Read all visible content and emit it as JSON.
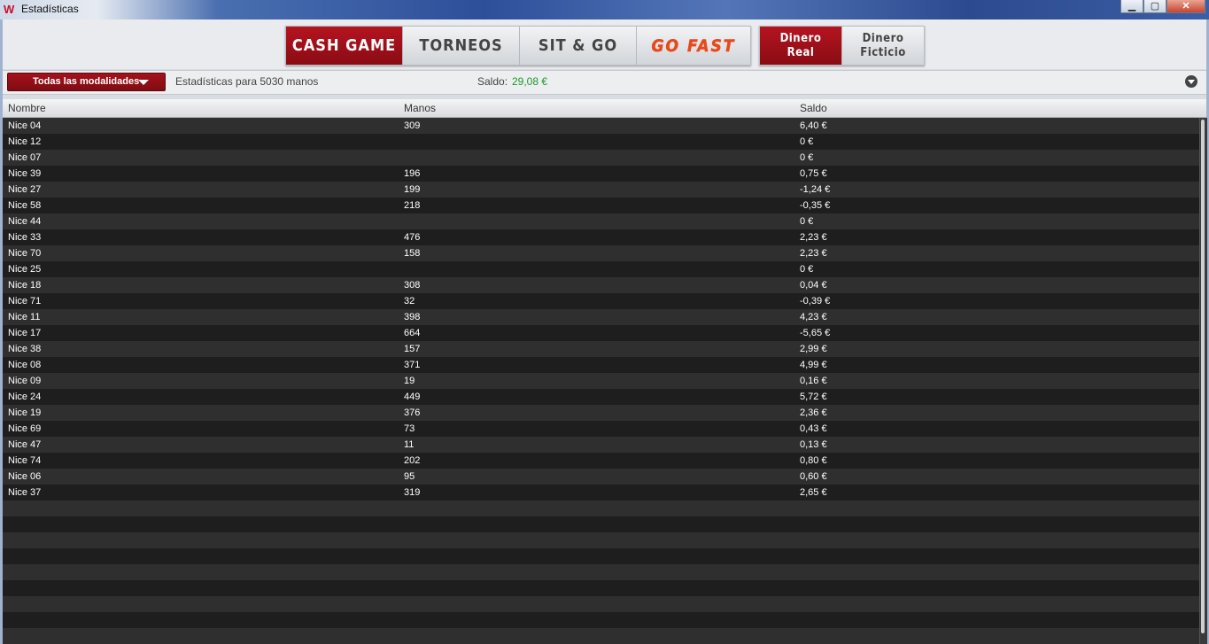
{
  "window": {
    "title": "Estadísticas",
    "buttons": {
      "minimize": "▁",
      "maximize": "▢",
      "close": "✕"
    }
  },
  "nav": {
    "game_tabs": [
      {
        "label": "CASH GAME",
        "active": true
      },
      {
        "label": "TORNEOS",
        "active": false
      },
      {
        "label": "SIT & GO",
        "active": false
      },
      {
        "label": "GO FAST",
        "active": false
      }
    ],
    "money_tabs": [
      {
        "line1": "Dinero",
        "line2": "Real",
        "active": true
      },
      {
        "line1": "Dinero",
        "line2": "Ficticio",
        "active": false
      }
    ]
  },
  "filter": {
    "dropdown_label": "Todas las modalidades",
    "stats_text": "Estadísticas para 5030 manos",
    "saldo_label": "Saldo:",
    "saldo_value": "29,08 €"
  },
  "table": {
    "headers": {
      "name": "Nombre",
      "hands": "Manos",
      "balance": "Saldo"
    },
    "rows": [
      {
        "name": "Nice 04",
        "hands": "309",
        "balance": "6,40 €"
      },
      {
        "name": "Nice 12",
        "hands": "",
        "balance": "0 €"
      },
      {
        "name": "Nice 07",
        "hands": "",
        "balance": "0 €"
      },
      {
        "name": "Nice 39",
        "hands": "196",
        "balance": "0,75 €"
      },
      {
        "name": "Nice 27",
        "hands": "199",
        "balance": "-1,24 €"
      },
      {
        "name": "Nice 58",
        "hands": "218",
        "balance": "-0,35 €"
      },
      {
        "name": "Nice 44",
        "hands": "",
        "balance": "0 €"
      },
      {
        "name": "Nice 33",
        "hands": "476",
        "balance": "2,23 €"
      },
      {
        "name": "Nice 70",
        "hands": "158",
        "balance": "2,23 €"
      },
      {
        "name": "Nice 25",
        "hands": "",
        "balance": "0 €"
      },
      {
        "name": "Nice 18",
        "hands": "308",
        "balance": "0,04 €"
      },
      {
        "name": "Nice 71",
        "hands": "32",
        "balance": "-0,39 €"
      },
      {
        "name": "Nice 11",
        "hands": "398",
        "balance": "4,23 €"
      },
      {
        "name": "Nice 17",
        "hands": "664",
        "balance": "-5,65 €"
      },
      {
        "name": "Nice 38",
        "hands": "157",
        "balance": "2,99 €"
      },
      {
        "name": "Nice 08",
        "hands": "371",
        "balance": "4,99 €"
      },
      {
        "name": "Nice 09",
        "hands": "19",
        "balance": "0,16 €"
      },
      {
        "name": "Nice 24",
        "hands": "449",
        "balance": "5,72 €"
      },
      {
        "name": "Nice 19",
        "hands": "376",
        "balance": "2,36 €"
      },
      {
        "name": "Nice 69",
        "hands": "73",
        "balance": "0,43 €"
      },
      {
        "name": "Nice 47",
        "hands": "11",
        "balance": "0,13 €"
      },
      {
        "name": "Nice 74",
        "hands": "202",
        "balance": "0,80 €"
      },
      {
        "name": "Nice 06",
        "hands": "95",
        "balance": "0,60 €"
      },
      {
        "name": "Nice 37",
        "hands": "319",
        "balance": "2,65 €"
      }
    ]
  }
}
